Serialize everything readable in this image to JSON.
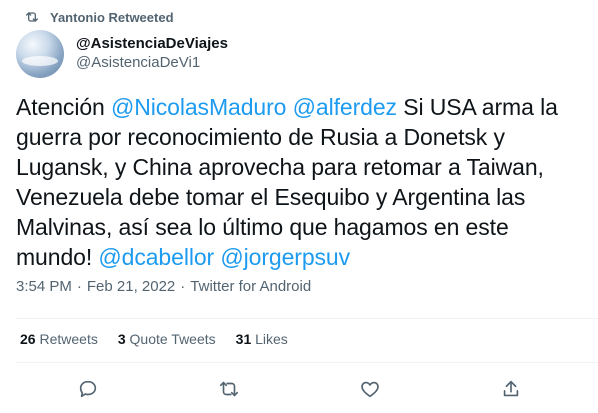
{
  "retweet_header": {
    "label": "Yantonio Retweeted"
  },
  "author": {
    "display_name": "@AsistenciaDeViajes",
    "handle": "@AsistenciaDeVi1"
  },
  "tweet": {
    "segments": [
      {
        "text": "Atención ",
        "type": "text"
      },
      {
        "text": "@NicolasMaduro",
        "type": "mention"
      },
      {
        "text": " ",
        "type": "text"
      },
      {
        "text": "@alferdez",
        "type": "mention"
      },
      {
        "text": " Si USA arma la guerra por reconocimiento de Rusia a Donetsk y Lugansk, y China aprovecha para retomar a Taiwan, Venezuela debe tomar el Esequibo y Argentina las Malvinas, así sea lo último que hagamos en este mundo! ",
        "type": "text"
      },
      {
        "text": "@dcabellor",
        "type": "mention"
      },
      {
        "text": " ",
        "type": "text"
      },
      {
        "text": "@jorgerpsuv",
        "type": "mention"
      }
    ]
  },
  "meta": {
    "time": "3:54 PM",
    "sep1": "·",
    "date": "Feb 21, 2022",
    "sep2": "·",
    "source": "Twitter for Android"
  },
  "stats": {
    "retweets_count": "26",
    "retweets_label": "Retweets",
    "quotes_count": "3",
    "quotes_label": "Quote Tweets",
    "likes_count": "31",
    "likes_label": "Likes"
  },
  "actions": [
    "reply-icon",
    "retweet-icon",
    "like-icon",
    "share-icon"
  ],
  "colors": {
    "accent": "#1d9bf0",
    "secondary_text": "#536471",
    "primary_text": "#0f1419"
  }
}
